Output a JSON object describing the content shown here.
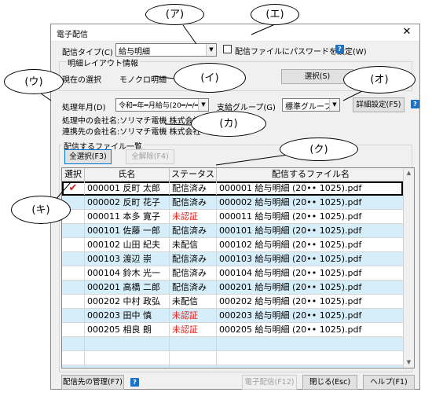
{
  "window": {
    "title": "電子配信",
    "close_glyph": "✕"
  },
  "form": {
    "delivery_type_label": "配信タイプ(C)",
    "delivery_type_value": "給与明細",
    "password_checkbox_label": "配信ファイルにパスワードを設定(W)",
    "layout_group_title": "明細レイアウト情報",
    "current_selection_label": "現在の選択",
    "current_selection_value": "モノクロ明細",
    "select_button": "選択(S)",
    "period_label": "処理年月(D)",
    "period_value": "令和━年━月給与(20━/━/━)",
    "branch_group_label": "支給グループ(G)",
    "branch_group_value": "標準グループ",
    "detail_settings_button": "詳細設定(F5)",
    "processing_company": "処理中の会社名:ソリマチ電機 株式会社",
    "linked_company": "連携先の会社名:ソリマチ電機 株式会社",
    "file_group_title": "配信するファイル一覧",
    "select_all_button": "全選択(F3)",
    "deselect_all_button": "全解除(F4)"
  },
  "table": {
    "headers": [
      "選択",
      "氏名",
      "ステータス",
      "配信するファイル名"
    ],
    "rows": [
      {
        "check": "✔",
        "name": "000001 反町 太郎",
        "status": "配信済み",
        "file": "000001 給与明細 (20•• 1025).pdf",
        "red": false
      },
      {
        "check": "",
        "name": "000002 反町 花子",
        "status": "配信済み",
        "file": "000002 給与明細 (20•• 1025).pdf",
        "red": false
      },
      {
        "check": "",
        "name": "000011 本多 寛子",
        "status": "未認証",
        "file": "000011 給与明細 (20•• 1025).pdf",
        "red": true
      },
      {
        "check": "",
        "name": "000101 佐藤 一郎",
        "status": "配信済み",
        "file": "000101 給与明細 (20•• 1025).pdf",
        "red": false
      },
      {
        "check": "",
        "name": "000102 山田 紀夫",
        "status": "未配信",
        "file": "000102 給与明細 (20•• 1025).pdf",
        "red": false
      },
      {
        "check": "",
        "name": "000103 渡辺 崇",
        "status": "配信済み",
        "file": "000103 給与明細 (20•• 1025).pdf",
        "red": false
      },
      {
        "check": "",
        "name": "000104 鈴木 光一",
        "status": "配信済み",
        "file": "000104 給与明細 (20•• 1025).pdf",
        "red": false
      },
      {
        "check": "",
        "name": "000201 高橋 二郎",
        "status": "配信済み",
        "file": "000201 給与明細 (20•• 1025).pdf",
        "red": false
      },
      {
        "check": "",
        "name": "000202 中村 政弘",
        "status": "未配信",
        "file": "000202 給与明細 (20•• 1025).pdf",
        "red": false
      },
      {
        "check": "",
        "name": "000203 田中 慎",
        "status": "未認証",
        "file": "000203 給与明細 (20•• 1025).pdf",
        "red": true
      },
      {
        "check": "",
        "name": "000205 相良 朗",
        "status": "未認証",
        "file": "000205 給与明細 (20•• 1025).pdf",
        "red": true
      }
    ],
    "empty_rows": 3
  },
  "footer": {
    "manage_button": "配信先の管理(F7)",
    "send_button": "電子配信(F12)",
    "close_button": "閉じる(Esc)",
    "help_button": "ヘルプ(F1)"
  },
  "help_glyph": "?",
  "callouts": {
    "a": "(ア)",
    "e": "(エ)",
    "u": "(ウ)",
    "i": "(イ)",
    "o": "(オ)",
    "ka": "(カ)",
    "ku": "(ク)",
    "ki": "(キ)"
  },
  "colors": {
    "alt_row": "#d6eefa",
    "status_red": "#e0201c",
    "help_blue": "#1a73c8"
  }
}
